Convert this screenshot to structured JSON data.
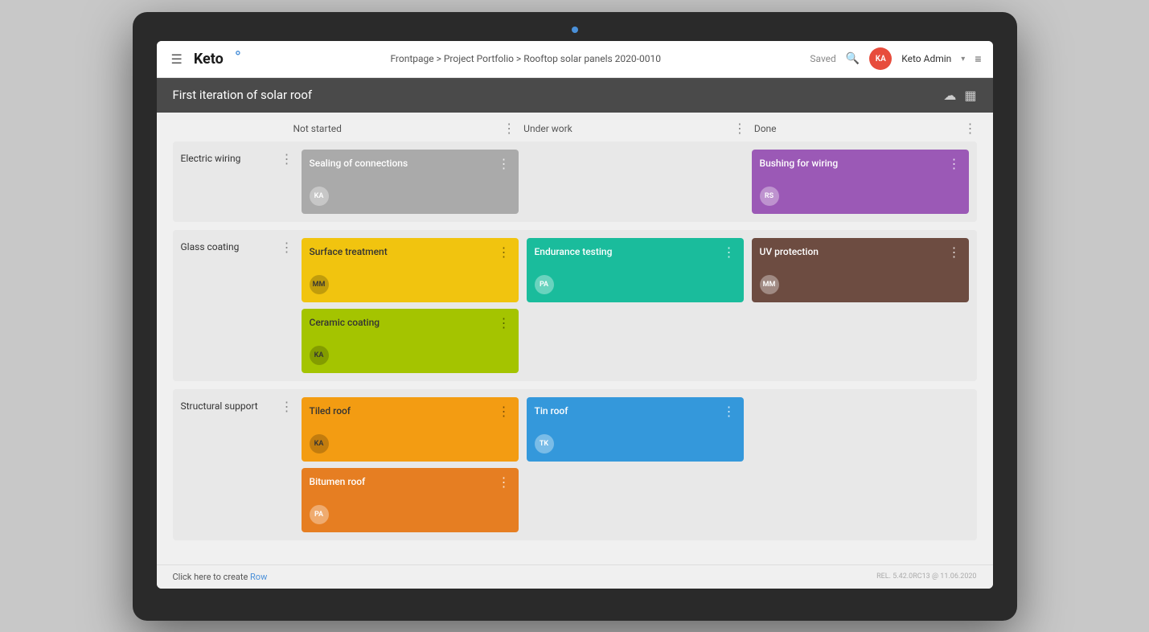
{
  "topbar": {
    "menu_icon": "☰",
    "logo_text": "Keto",
    "logo_dot": "°",
    "breadcrumb": "Frontpage > Project Portfolio > Rooftop solar panels 2020-0010",
    "saved_label": "Saved",
    "search_icon": "🔍",
    "user_initials": "KA",
    "user_name": "Keto Admin",
    "chevron": "▾",
    "hamburger": "≡"
  },
  "page_header": {
    "title": "First iteration of solar roof",
    "upload_icon": "☁",
    "layout_icon": "▦"
  },
  "columns": [
    {
      "id": "not_started",
      "label": "Not started"
    },
    {
      "id": "under_work",
      "label": "Under work"
    },
    {
      "id": "done",
      "label": "Done"
    }
  ],
  "rows": [
    {
      "id": "electric_wiring",
      "label": "Electric wiring",
      "not_started": [
        {
          "title": "Sealing of connections",
          "color": "card-gray",
          "avatar": "KA"
        }
      ],
      "under_work": [],
      "done": [
        {
          "title": "Bushing for wiring",
          "color": "card-purple",
          "avatar": "RS"
        }
      ]
    },
    {
      "id": "glass_coating",
      "label": "Glass coating",
      "not_started": [
        {
          "title": "Surface treatment",
          "color": "card-yellow",
          "avatar": "MM"
        },
        {
          "title": "Ceramic coating",
          "color": "card-lime",
          "avatar": "KA"
        }
      ],
      "under_work": [
        {
          "title": "Endurance testing",
          "color": "card-teal",
          "avatar": "PA"
        }
      ],
      "done": [
        {
          "title": "UV protection",
          "color": "card-brown",
          "avatar": "MM"
        }
      ]
    },
    {
      "id": "structural_support",
      "label": "Structural support",
      "not_started": [
        {
          "title": "Tiled roof",
          "color": "card-amber",
          "avatar": "KA"
        },
        {
          "title": "Bitumen roof",
          "color": "card-orange",
          "avatar": "PA"
        }
      ],
      "under_work": [
        {
          "title": "Tin roof",
          "color": "card-blue",
          "avatar": "TK"
        }
      ],
      "done": []
    }
  ],
  "footer": {
    "create_text": "Click here to create",
    "create_link": "Row",
    "version": "REL. 5.42.0RC13 @ 11.06.2020"
  }
}
